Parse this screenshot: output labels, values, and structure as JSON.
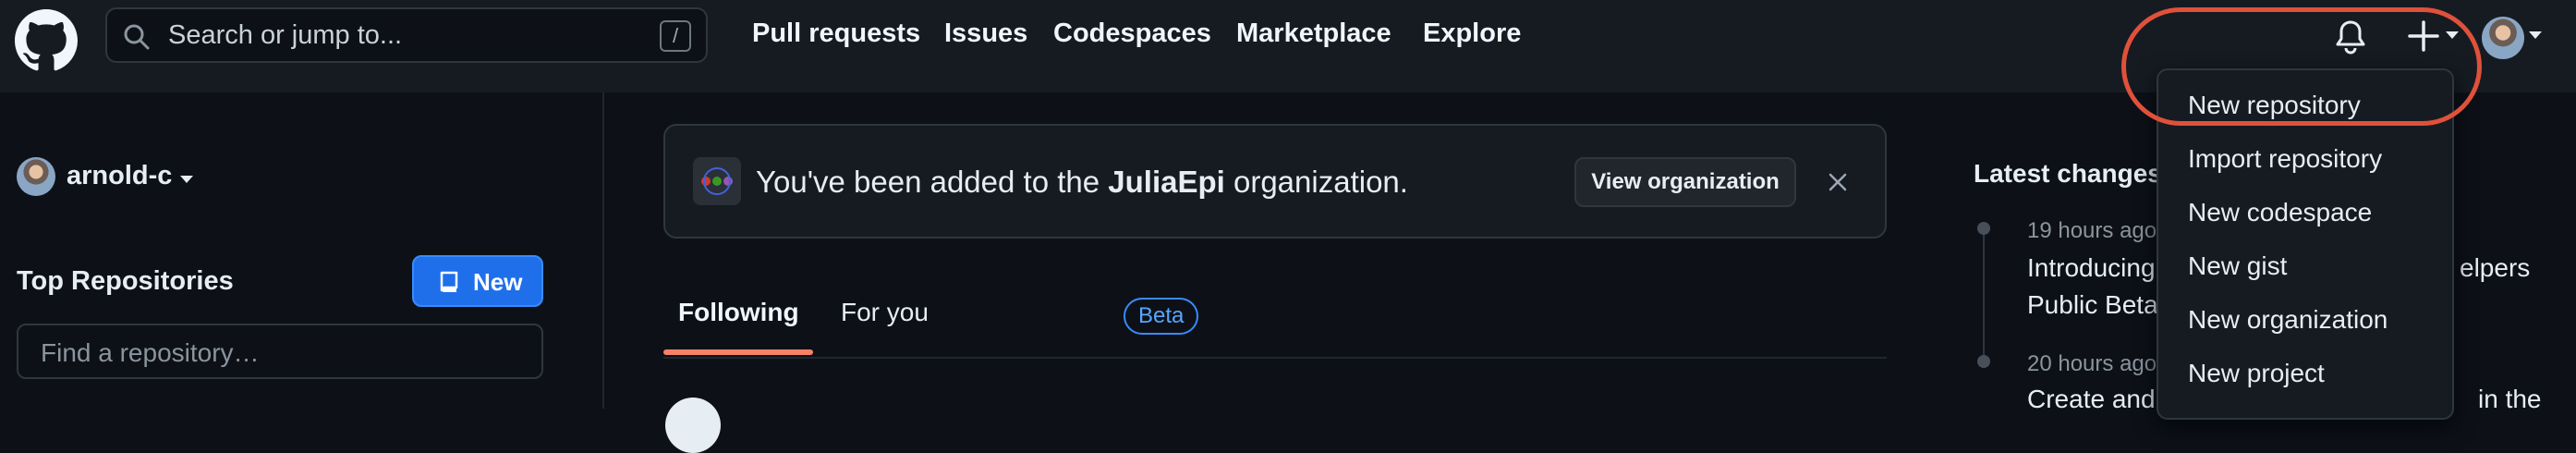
{
  "header": {
    "search_placeholder": "Search or jump to...",
    "search_shortcut": "/",
    "nav": [
      "Pull requests",
      "Issues",
      "Codespaces",
      "Marketplace",
      "Explore"
    ]
  },
  "create_menu": {
    "items": [
      "New repository",
      "Import repository",
      "New codespace",
      "New gist",
      "New organization",
      "New project"
    ]
  },
  "sidebar": {
    "username": "arnold-c",
    "top_repositories_title": "Top Repositories",
    "new_button": "New",
    "find_placeholder": "Find a repository…"
  },
  "banner": {
    "prefix": "You've been added to the ",
    "org": "JuliaEpi",
    "suffix": " organization.",
    "view_button": "View organization"
  },
  "feed_tabs": {
    "following": "Following",
    "for_you": "For you",
    "beta_badge": "Beta"
  },
  "changelog": {
    "title": "Latest changes",
    "entries": [
      {
        "time": "19 hours ago",
        "title_line1": "Introducing",
        "title_tail": "elpers",
        "title_line2": "Public Beta"
      },
      {
        "time": "20 hours ago",
        "title_line1": "Create and",
        "title_tail": "in the"
      }
    ]
  },
  "colors": {
    "annotation_circle": "#e0513a",
    "primary_button": "#1f6feb",
    "tab_underline": "#f78166"
  }
}
